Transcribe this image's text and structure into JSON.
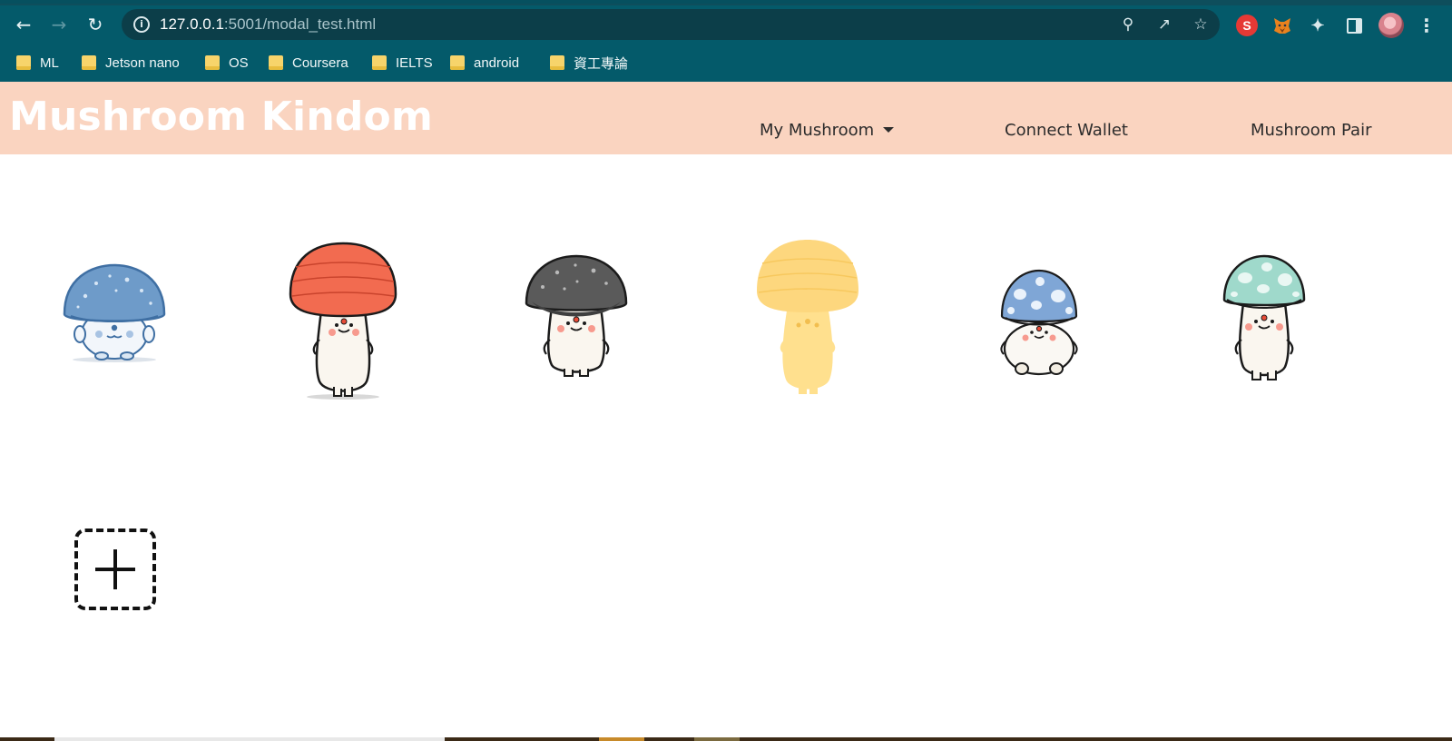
{
  "browser": {
    "url_host": "127.0.0.1",
    "url_rest": ":5001/modal_test.html",
    "extension_s_label": "S",
    "bookmarks": [
      "ML",
      "Jetson nano",
      "OS",
      "Coursera",
      "IELTS",
      "android",
      "資工專論"
    ]
  },
  "navbar": {
    "brand": "Mushroom Kindom",
    "links": [
      "My Mushroom",
      "Connect Wallet",
      "Mushroom Pair"
    ]
  },
  "mushrooms": [
    {
      "name": "blue-spotted-mushroom",
      "cap_color": "#6e9bc9",
      "body_color": "#f2f6fb"
    },
    {
      "name": "red-mushroom",
      "cap_color": "#f26b50",
      "body_color": "#faf6ef"
    },
    {
      "name": "gray-mushroom",
      "cap_color": "#5a5a5a",
      "body_color": "#faf6ef"
    },
    {
      "name": "yellow-mushroom",
      "cap_color": "#fdd77e",
      "body_color": "#ffe08e"
    },
    {
      "name": "blue-white-spotted-mushroom",
      "cap_color": "#7fa6d6",
      "body_color": "#faf8f3"
    },
    {
      "name": "mint-spotted-mushroom",
      "cap_color": "#9fd9cb",
      "body_color": "#faf6ef"
    }
  ],
  "add_button": {
    "icon": "plus-icon"
  }
}
